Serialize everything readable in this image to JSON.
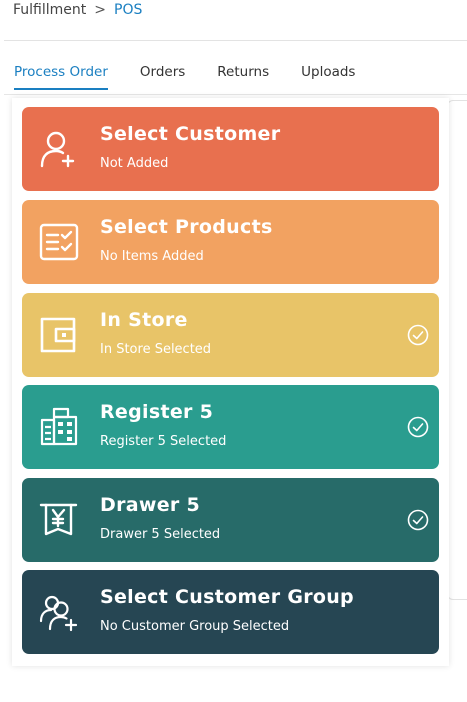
{
  "breadcrumb": {
    "parent": "Fulfillment",
    "separator": ">",
    "current": "POS"
  },
  "tabs": [
    {
      "label": "Process Order",
      "active": true
    },
    {
      "label": "Orders",
      "active": false
    },
    {
      "label": "Returns",
      "active": false
    },
    {
      "label": "Uploads",
      "active": false
    }
  ],
  "steps": [
    {
      "title": "Select Customer",
      "subtitle": "Not Added",
      "icon": "user-plus-icon",
      "color": "#e8704f",
      "completed": false
    },
    {
      "title": "Select Products",
      "subtitle": "No Items Added",
      "icon": "checklist-icon",
      "color": "#f2a261",
      "completed": false
    },
    {
      "title": "In Store",
      "subtitle": "In Store Selected",
      "icon": "store-icon",
      "color": "#e8c468",
      "completed": true
    },
    {
      "title": "Register 5",
      "subtitle": "Register 5 Selected",
      "icon": "register-icon",
      "color": "#2a9d8f",
      "completed": true
    },
    {
      "title": "Drawer 5",
      "subtitle": "Drawer 5 Selected",
      "icon": "drawer-yen-icon",
      "color": "#276b69",
      "completed": true
    },
    {
      "title": "Select Customer Group",
      "subtitle": "No Customer Group Selected",
      "icon": "user-group-plus-icon",
      "color": "#264653",
      "completed": false
    }
  ],
  "colors": {
    "accent": "#1a7fc1"
  }
}
